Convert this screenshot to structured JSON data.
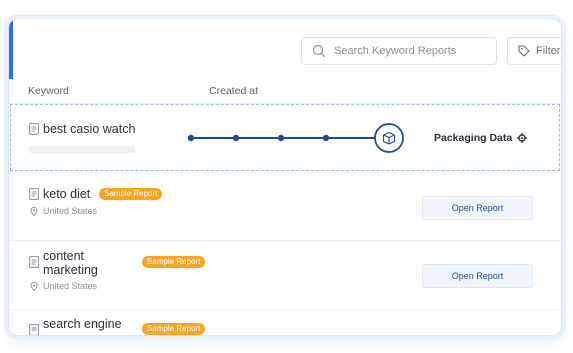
{
  "toolbar": {
    "search_placeholder": "Search Keyword Reports",
    "filter_label": "Filter",
    "search_icon": "search-icon",
    "filter_icon": "tag-icon"
  },
  "columns": {
    "keyword": "Keyword",
    "created_at": "Created at"
  },
  "colors": {
    "accent": "#2f6fe0",
    "progress_line": "#1f4a9c",
    "badge": "#f7a623",
    "button_bg": "#f0f4fb",
    "button_text": "#1f4a9c"
  },
  "rows": [
    {
      "keyword": "best casio watch",
      "status": "Packaging Data",
      "status_icon": "gear-icon",
      "progress": {
        "steps_total": 5,
        "current_step": 5,
        "current_step_icon": "package-icon"
      }
    },
    {
      "keyword": "keto diet",
      "badge": "Sample Report",
      "location": "United States",
      "button": "Open Report"
    },
    {
      "keyword_line1": "content",
      "keyword_line2": "marketing",
      "badge": "Sample Report",
      "location": "United States",
      "button": "Open Report"
    },
    {
      "keyword": "search engine",
      "badge": "Sample Report"
    }
  ]
}
